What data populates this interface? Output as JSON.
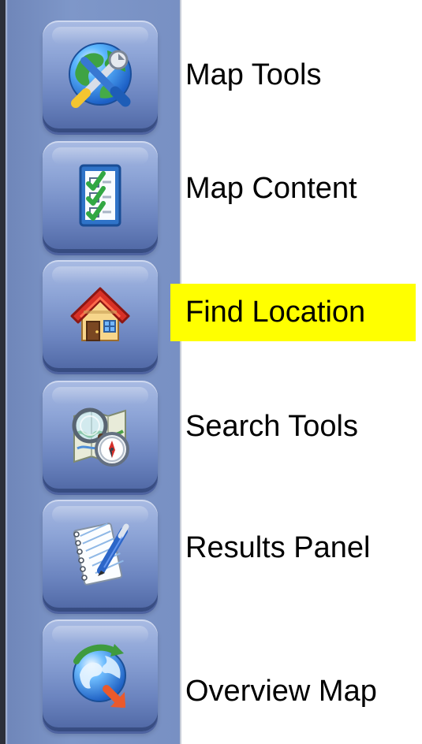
{
  "sidebar": {
    "items": [
      {
        "label": "Map Tools",
        "icon": "globe-tools-icon"
      },
      {
        "label": "Map Content",
        "icon": "checklist-icon"
      },
      {
        "label": "Find Location",
        "icon": "house-icon"
      },
      {
        "label": "Search Tools",
        "icon": "magnifier-compass-icon"
      },
      {
        "label": "Results Panel",
        "icon": "notepad-pen-icon"
      },
      {
        "label": "Overview Map",
        "icon": "globe-arrows-icon"
      }
    ],
    "highlighted_label_index": 2,
    "highlight_color": "#ffff00"
  }
}
